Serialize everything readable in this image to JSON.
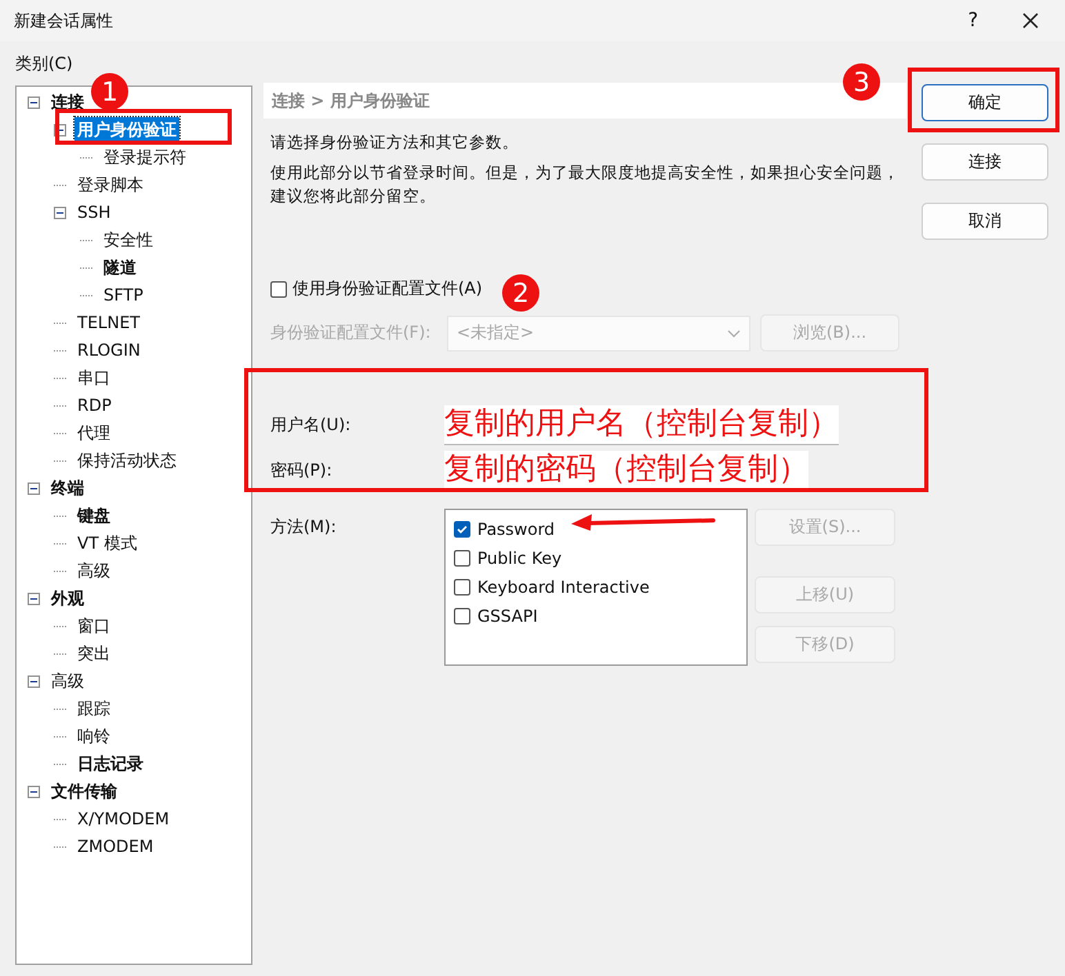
{
  "window": {
    "title": "新建会话属性",
    "help": "?"
  },
  "category_label": "类别(C)",
  "tree": [
    {
      "label": "连接",
      "bold": true,
      "expanded": true,
      "selected": false,
      "children": [
        {
          "label": "用户身份验证",
          "bold": true,
          "expanded": true,
          "selected": true,
          "children": [
            {
              "label": "登录提示符",
              "bold": false,
              "selected": false
            }
          ]
        },
        {
          "label": "登录脚本",
          "bold": false,
          "selected": false
        },
        {
          "label": "SSH",
          "bold": false,
          "expanded": true,
          "selected": false,
          "children": [
            {
              "label": "安全性",
              "bold": false,
              "selected": false
            },
            {
              "label": "隧道",
              "bold": true,
              "selected": false
            },
            {
              "label": "SFTP",
              "bold": false,
              "selected": false
            }
          ]
        },
        {
          "label": "TELNET",
          "bold": false,
          "selected": false
        },
        {
          "label": "RLOGIN",
          "bold": false,
          "selected": false
        },
        {
          "label": "串口",
          "bold": false,
          "selected": false
        },
        {
          "label": "RDP",
          "bold": false,
          "selected": false
        },
        {
          "label": "代理",
          "bold": false,
          "selected": false
        },
        {
          "label": "保持活动状态",
          "bold": false,
          "selected": false
        }
      ]
    },
    {
      "label": "终端",
      "bold": true,
      "expanded": true,
      "selected": false,
      "children": [
        {
          "label": "键盘",
          "bold": true,
          "selected": false
        },
        {
          "label": "VT 模式",
          "bold": false,
          "selected": false
        },
        {
          "label": "高级",
          "bold": false,
          "selected": false
        }
      ]
    },
    {
      "label": "外观",
      "bold": true,
      "expanded": true,
      "selected": false,
      "children": [
        {
          "label": "窗口",
          "bold": false,
          "selected": false
        },
        {
          "label": "突出",
          "bold": false,
          "selected": false
        }
      ]
    },
    {
      "label": "高级",
      "bold": false,
      "expanded": true,
      "selected": false,
      "children": [
        {
          "label": "跟踪",
          "bold": false,
          "selected": false
        },
        {
          "label": "响铃",
          "bold": false,
          "selected": false
        },
        {
          "label": "日志记录",
          "bold": true,
          "selected": false
        }
      ]
    },
    {
      "label": "文件传输",
      "bold": true,
      "expanded": true,
      "selected": false,
      "children": [
        {
          "label": "X/YMODEM",
          "bold": false,
          "selected": false
        },
        {
          "label": "ZMODEM",
          "bold": false,
          "selected": false
        }
      ]
    }
  ],
  "breadcrumb": "连接 > 用户身份验证",
  "description": [
    "请选择身份验证方法和其它参数。",
    "使用此部分以节省登录时间。但是，为了最大限度地提高安全性，如果担心安全问题，建议您将此部分留空。"
  ],
  "use_profile": {
    "label": "使用身份验证配置文件(A)",
    "checked": false
  },
  "profile": {
    "label": "身份验证配置文件(F):",
    "value": "<未指定>",
    "disabled": true,
    "browse": "浏览(B)..."
  },
  "username": {
    "label": "用户名(U):",
    "value": "复制的用户名（控制台复制）"
  },
  "password": {
    "label": "密码(P):",
    "value": "复制的密码（控制台复制）"
  },
  "method": {
    "label": "方法(M):",
    "options": [
      {
        "label": "Password",
        "checked": true
      },
      {
        "label": "Public Key",
        "checked": false
      },
      {
        "label": "Keyboard Interactive",
        "checked": false
      },
      {
        "label": "GSSAPI",
        "checked": false
      }
    ],
    "buttons": [
      {
        "label": "设置(S)...",
        "disabled": true
      },
      {
        "label": "上移(U)",
        "disabled": true
      },
      {
        "label": "下移(D)",
        "disabled": true
      }
    ]
  },
  "dialog_buttons": [
    {
      "label": "确定",
      "default": true
    },
    {
      "label": "连接",
      "default": false
    },
    {
      "label": "取消",
      "default": false
    }
  ],
  "annotations": [
    {
      "kind": "badge",
      "label": "1"
    },
    {
      "kind": "badge",
      "label": "2"
    },
    {
      "kind": "badge",
      "label": "3"
    },
    {
      "kind": "highlight"
    },
    {
      "kind": "highlight"
    },
    {
      "kind": "highlight"
    },
    {
      "kind": "arrow"
    }
  ]
}
